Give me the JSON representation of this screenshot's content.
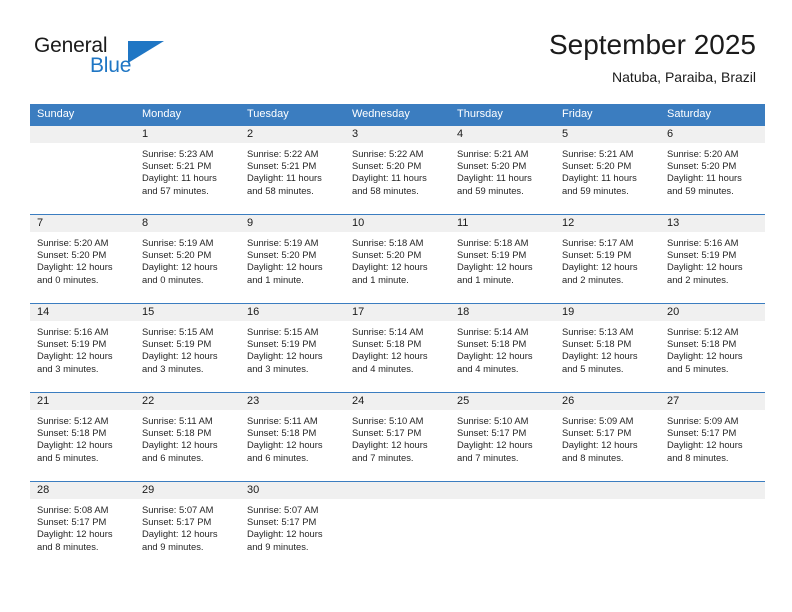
{
  "brand": {
    "name_top": "General",
    "name_bottom": "Blue",
    "accent_color": "#1f76c4"
  },
  "header": {
    "title": "September 2025",
    "subtitle": "Natuba, Paraiba, Brazil"
  },
  "theme": {
    "header_row_bg": "#3b7dc0",
    "daynum_band_bg": "#f0f0f0",
    "text_color": "#262626"
  },
  "weekdays": [
    "Sunday",
    "Monday",
    "Tuesday",
    "Wednesday",
    "Thursday",
    "Friday",
    "Saturday"
  ],
  "weeks": [
    [
      {
        "day": "",
        "sunrise": "",
        "sunset": "",
        "daylight_line1": "",
        "daylight_line2": ""
      },
      {
        "day": "1",
        "sunrise": "Sunrise: 5:23 AM",
        "sunset": "Sunset: 5:21 PM",
        "daylight_line1": "Daylight: 11 hours",
        "daylight_line2": "and 57 minutes."
      },
      {
        "day": "2",
        "sunrise": "Sunrise: 5:22 AM",
        "sunset": "Sunset: 5:21 PM",
        "daylight_line1": "Daylight: 11 hours",
        "daylight_line2": "and 58 minutes."
      },
      {
        "day": "3",
        "sunrise": "Sunrise: 5:22 AM",
        "sunset": "Sunset: 5:20 PM",
        "daylight_line1": "Daylight: 11 hours",
        "daylight_line2": "and 58 minutes."
      },
      {
        "day": "4",
        "sunrise": "Sunrise: 5:21 AM",
        "sunset": "Sunset: 5:20 PM",
        "daylight_line1": "Daylight: 11 hours",
        "daylight_line2": "and 59 minutes."
      },
      {
        "day": "5",
        "sunrise": "Sunrise: 5:21 AM",
        "sunset": "Sunset: 5:20 PM",
        "daylight_line1": "Daylight: 11 hours",
        "daylight_line2": "and 59 minutes."
      },
      {
        "day": "6",
        "sunrise": "Sunrise: 5:20 AM",
        "sunset": "Sunset: 5:20 PM",
        "daylight_line1": "Daylight: 11 hours",
        "daylight_line2": "and 59 minutes."
      }
    ],
    [
      {
        "day": "7",
        "sunrise": "Sunrise: 5:20 AM",
        "sunset": "Sunset: 5:20 PM",
        "daylight_line1": "Daylight: 12 hours",
        "daylight_line2": "and 0 minutes."
      },
      {
        "day": "8",
        "sunrise": "Sunrise: 5:19 AM",
        "sunset": "Sunset: 5:20 PM",
        "daylight_line1": "Daylight: 12 hours",
        "daylight_line2": "and 0 minutes."
      },
      {
        "day": "9",
        "sunrise": "Sunrise: 5:19 AM",
        "sunset": "Sunset: 5:20 PM",
        "daylight_line1": "Daylight: 12 hours",
        "daylight_line2": "and 1 minute."
      },
      {
        "day": "10",
        "sunrise": "Sunrise: 5:18 AM",
        "sunset": "Sunset: 5:20 PM",
        "daylight_line1": "Daylight: 12 hours",
        "daylight_line2": "and 1 minute."
      },
      {
        "day": "11",
        "sunrise": "Sunrise: 5:18 AM",
        "sunset": "Sunset: 5:19 PM",
        "daylight_line1": "Daylight: 12 hours",
        "daylight_line2": "and 1 minute."
      },
      {
        "day": "12",
        "sunrise": "Sunrise: 5:17 AM",
        "sunset": "Sunset: 5:19 PM",
        "daylight_line1": "Daylight: 12 hours",
        "daylight_line2": "and 2 minutes."
      },
      {
        "day": "13",
        "sunrise": "Sunrise: 5:16 AM",
        "sunset": "Sunset: 5:19 PM",
        "daylight_line1": "Daylight: 12 hours",
        "daylight_line2": "and 2 minutes."
      }
    ],
    [
      {
        "day": "14",
        "sunrise": "Sunrise: 5:16 AM",
        "sunset": "Sunset: 5:19 PM",
        "daylight_line1": "Daylight: 12 hours",
        "daylight_line2": "and 3 minutes."
      },
      {
        "day": "15",
        "sunrise": "Sunrise: 5:15 AM",
        "sunset": "Sunset: 5:19 PM",
        "daylight_line1": "Daylight: 12 hours",
        "daylight_line2": "and 3 minutes."
      },
      {
        "day": "16",
        "sunrise": "Sunrise: 5:15 AM",
        "sunset": "Sunset: 5:19 PM",
        "daylight_line1": "Daylight: 12 hours",
        "daylight_line2": "and 3 minutes."
      },
      {
        "day": "17",
        "sunrise": "Sunrise: 5:14 AM",
        "sunset": "Sunset: 5:18 PM",
        "daylight_line1": "Daylight: 12 hours",
        "daylight_line2": "and 4 minutes."
      },
      {
        "day": "18",
        "sunrise": "Sunrise: 5:14 AM",
        "sunset": "Sunset: 5:18 PM",
        "daylight_line1": "Daylight: 12 hours",
        "daylight_line2": "and 4 minutes."
      },
      {
        "day": "19",
        "sunrise": "Sunrise: 5:13 AM",
        "sunset": "Sunset: 5:18 PM",
        "daylight_line1": "Daylight: 12 hours",
        "daylight_line2": "and 5 minutes."
      },
      {
        "day": "20",
        "sunrise": "Sunrise: 5:12 AM",
        "sunset": "Sunset: 5:18 PM",
        "daylight_line1": "Daylight: 12 hours",
        "daylight_line2": "and 5 minutes."
      }
    ],
    [
      {
        "day": "21",
        "sunrise": "Sunrise: 5:12 AM",
        "sunset": "Sunset: 5:18 PM",
        "daylight_line1": "Daylight: 12 hours",
        "daylight_line2": "and 5 minutes."
      },
      {
        "day": "22",
        "sunrise": "Sunrise: 5:11 AM",
        "sunset": "Sunset: 5:18 PM",
        "daylight_line1": "Daylight: 12 hours",
        "daylight_line2": "and 6 minutes."
      },
      {
        "day": "23",
        "sunrise": "Sunrise: 5:11 AM",
        "sunset": "Sunset: 5:18 PM",
        "daylight_line1": "Daylight: 12 hours",
        "daylight_line2": "and 6 minutes."
      },
      {
        "day": "24",
        "sunrise": "Sunrise: 5:10 AM",
        "sunset": "Sunset: 5:17 PM",
        "daylight_line1": "Daylight: 12 hours",
        "daylight_line2": "and 7 minutes."
      },
      {
        "day": "25",
        "sunrise": "Sunrise: 5:10 AM",
        "sunset": "Sunset: 5:17 PM",
        "daylight_line1": "Daylight: 12 hours",
        "daylight_line2": "and 7 minutes."
      },
      {
        "day": "26",
        "sunrise": "Sunrise: 5:09 AM",
        "sunset": "Sunset: 5:17 PM",
        "daylight_line1": "Daylight: 12 hours",
        "daylight_line2": "and 8 minutes."
      },
      {
        "day": "27",
        "sunrise": "Sunrise: 5:09 AM",
        "sunset": "Sunset: 5:17 PM",
        "daylight_line1": "Daylight: 12 hours",
        "daylight_line2": "and 8 minutes."
      }
    ],
    [
      {
        "day": "28",
        "sunrise": "Sunrise: 5:08 AM",
        "sunset": "Sunset: 5:17 PM",
        "daylight_line1": "Daylight: 12 hours",
        "daylight_line2": "and 8 minutes."
      },
      {
        "day": "29",
        "sunrise": "Sunrise: 5:07 AM",
        "sunset": "Sunset: 5:17 PM",
        "daylight_line1": "Daylight: 12 hours",
        "daylight_line2": "and 9 minutes."
      },
      {
        "day": "30",
        "sunrise": "Sunrise: 5:07 AM",
        "sunset": "Sunset: 5:17 PM",
        "daylight_line1": "Daylight: 12 hours",
        "daylight_line2": "and 9 minutes."
      },
      {
        "day": "",
        "sunrise": "",
        "sunset": "",
        "daylight_line1": "",
        "daylight_line2": ""
      },
      {
        "day": "",
        "sunrise": "",
        "sunset": "",
        "daylight_line1": "",
        "daylight_line2": ""
      },
      {
        "day": "",
        "sunrise": "",
        "sunset": "",
        "daylight_line1": "",
        "daylight_line2": ""
      },
      {
        "day": "",
        "sunrise": "",
        "sunset": "",
        "daylight_line1": "",
        "daylight_line2": ""
      }
    ]
  ]
}
